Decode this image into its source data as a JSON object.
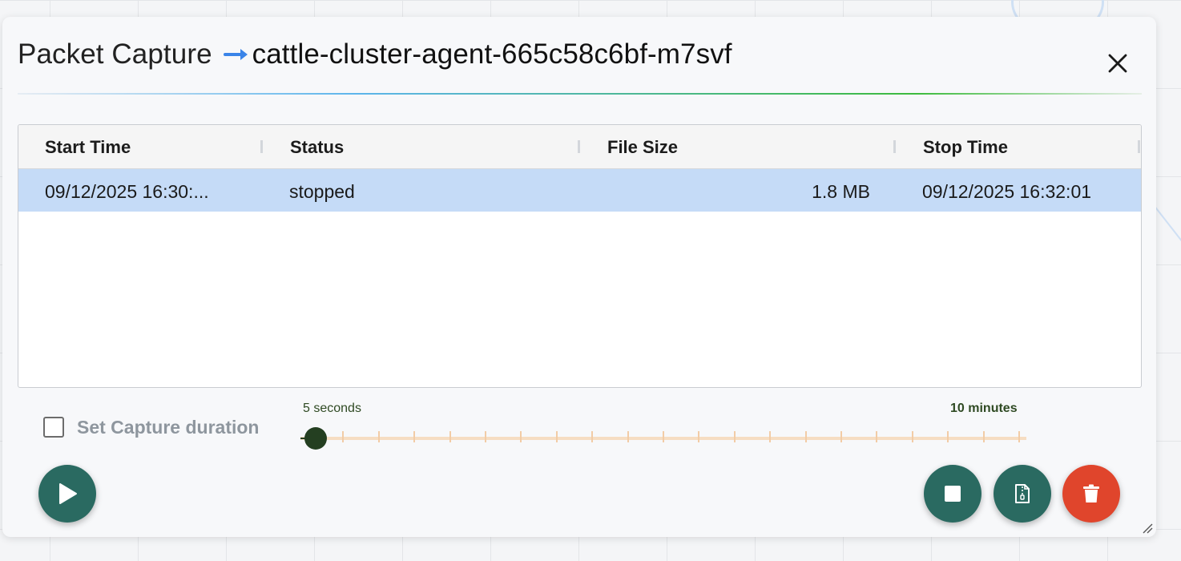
{
  "dialog": {
    "title": "Packet Capture",
    "pod_name": "cattle-cluster-agent-665c58c6bf-m7svf"
  },
  "table": {
    "columns": [
      "Start Time",
      "Status",
      "File Size",
      "Stop Time"
    ],
    "rows": [
      {
        "start_time": "09/12/2025 16:30:...",
        "status": "stopped",
        "file_size": "1.8 MB",
        "stop_time": "09/12/2025 16:32:01",
        "selected": true
      }
    ]
  },
  "duration": {
    "label": "Set Capture duration",
    "checked": false,
    "min_label": "5 seconds",
    "max_label": "10 minutes",
    "value_fraction": 0.0
  },
  "actions": {
    "start": {
      "icon": "play-icon",
      "color": "#2a6a61"
    },
    "stop": {
      "icon": "stop-icon",
      "color": "#2a6a61"
    },
    "download": {
      "icon": "file-archive-icon",
      "color": "#2a6a61"
    },
    "delete": {
      "icon": "trash-icon",
      "color": "#e0452c"
    }
  },
  "colors": {
    "selected_row": "#c5dbf7",
    "slider_thumb": "#243f21",
    "slider_track": "#f6ddc2",
    "title_arrow": "#3a84e8"
  }
}
